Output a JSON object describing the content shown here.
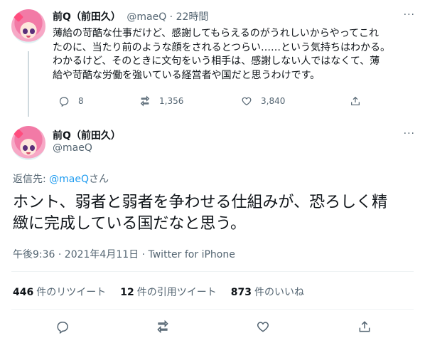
{
  "tweet1": {
    "name": "前Q（前田久）",
    "handle": "@maeQ",
    "separator": "·",
    "time": "22時間",
    "lines": [
      "薄給の苛酷な仕事だけど、感謝してもらえるのがうれしいからやってこれ",
      "たのに、当たり前のような顔をされるとつらい……という気持ちはわかる。",
      "わかるけど、そのときに文句をいう相手は、感謝しない人ではなくて、薄",
      "給や苛酷な労働を強いている経営者や国だと思うわけです。"
    ],
    "replies": "8",
    "retweets": "1,356",
    "likes": "3,840"
  },
  "tweet2": {
    "name": "前Q（前田久）",
    "handle": "@maeQ",
    "reply_prefix": "返信先: ",
    "reply_link": "@maeQ",
    "reply_suffix": "さん",
    "lines": [
      "ホント、弱者と弱者を争わせる仕組みが、恐ろしく精",
      "緻に完成している国だなと思う。"
    ],
    "datetime": "午後9:36 · 2021年4月11日 · ",
    "source": "Twitter for iPhone",
    "stats": {
      "retweets_count": "446",
      "retweets_label": "件のリツイート",
      "quotes_count": "12",
      "quotes_label": "件の引用ツイート",
      "likes_count": "873",
      "likes_label": "件のいいね"
    }
  },
  "more_label": "···",
  "colors": {
    "accent": "#1d9bf0",
    "muted": "#536471",
    "text": "#0f1419"
  },
  "icons": [
    "reply-icon",
    "retweet-icon",
    "like-icon",
    "share-icon",
    "more-icon"
  ]
}
